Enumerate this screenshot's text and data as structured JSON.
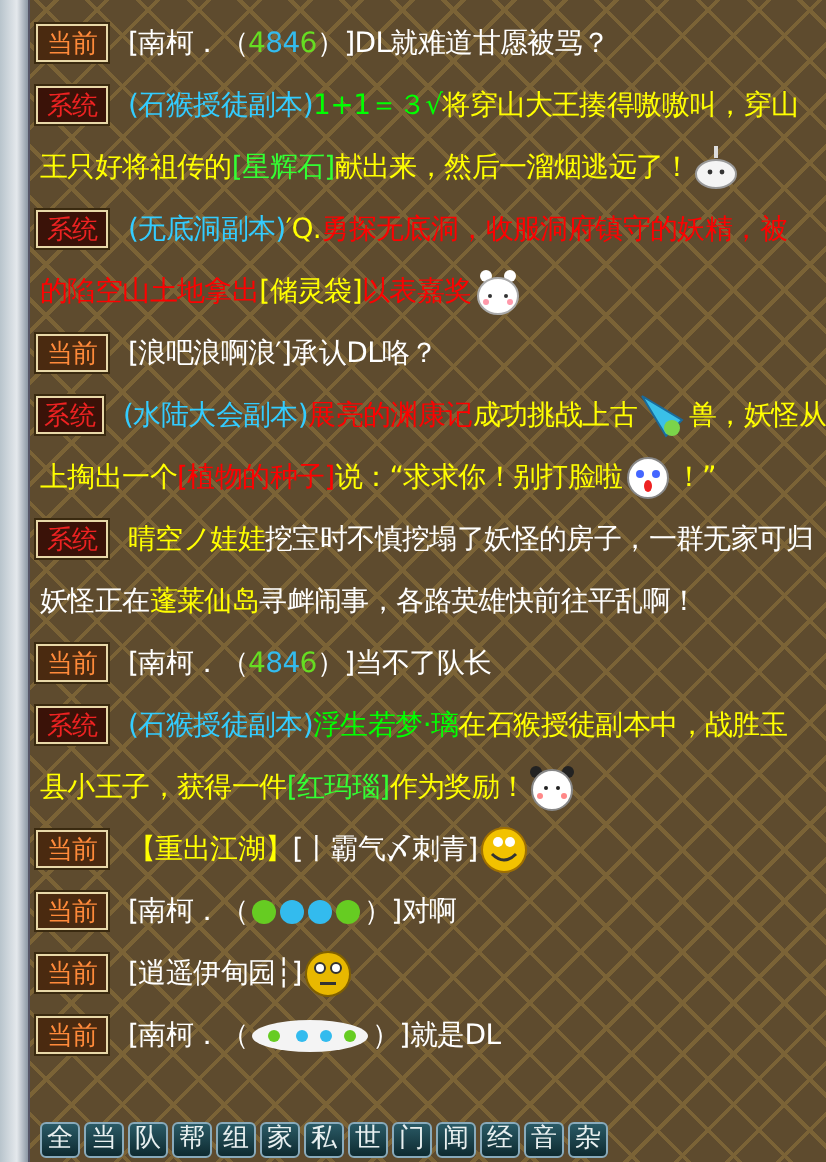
{
  "messages": [
    {
      "channel": {
        "kind": "current",
        "label": "当前"
      },
      "lines": [
        [
          {
            "text": "[南柯．（",
            "color": "#ffffff"
          },
          {
            "text": "4",
            "color": "#66dd22"
          },
          {
            "text": "8",
            "color": "#33bbee"
          },
          {
            "text": "4",
            "color": "#33bbee"
          },
          {
            "text": "6",
            "color": "#66dd22"
          },
          {
            "text": "）]DL就难道甘愿被骂？",
            "color": "#ffffff"
          }
        ]
      ]
    },
    {
      "channel": {
        "kind": "system",
        "label": "系统"
      },
      "lines": [
        [
          {
            "text": "(石猴授徒副本)",
            "color": "#33ccff"
          },
          {
            "text": "1+1＝３√",
            "color": "#00ff00"
          },
          {
            "text": "将穿山大王揍得嗷嗷叫，穿山",
            "color": "#ffff00"
          }
        ],
        [
          {
            "text": "王只好将祖传的",
            "color": "#ffff00"
          },
          {
            "text": "[星辉石]",
            "color": "#33ff33"
          },
          {
            "text": "献出来，然后一溜烟逃远了！",
            "color": "#ffff00"
          },
          {
            "kind": "ghost"
          }
        ]
      ]
    },
    {
      "channel": {
        "kind": "system",
        "label": "系统"
      },
      "lines": [
        [
          {
            "text": "(无底洞副本)",
            "color": "#33ccff"
          },
          {
            "text": "′Q.",
            "color": "#ffff00"
          },
          {
            "text": "勇探无底洞，收服洞府镇守的妖精，被",
            "color": "#ff0000"
          }
        ],
        [
          {
            "text": "的陷空山土地拿出",
            "color": "#ff0000"
          },
          {
            "text": "[储灵袋]",
            "color": "#ffff00"
          },
          {
            "text": "以表嘉奖",
            "color": "#ff0000"
          },
          {
            "kind": "bunny"
          }
        ]
      ]
    },
    {
      "channel": {
        "kind": "current",
        "label": "当前"
      },
      "lines": [
        [
          {
            "text": "[浪吧浪啊浪′]承认DL咯？",
            "color": "#ffffff"
          }
        ]
      ]
    },
    {
      "channel": {
        "kind": "system",
        "label": "系统"
      },
      "lines": [
        [
          {
            "text": "(水陆大会副本)",
            "color": "#33ccff"
          },
          {
            "text": "展亮的渊康记",
            "color": "#ff0000"
          },
          {
            "text": "成功挑战上古",
            "color": "#ffff00"
          },
          {
            "kind": "crystal"
          },
          {
            "text": "兽，妖怪从",
            "color": "#ffff00"
          }
        ],
        [
          {
            "text": "上掏出一个",
            "color": "#ffff00"
          },
          {
            "text": "[植物的种子]",
            "color": "#ff0000"
          },
          {
            "text": "说：“求求你！别打脸啦",
            "color": "#ffff00"
          },
          {
            "kind": "crying"
          },
          {
            "text": "！”",
            "color": "#ffff00"
          }
        ]
      ]
    },
    {
      "channel": {
        "kind": "system",
        "label": "系统"
      },
      "lines": [
        [
          {
            "text": "晴空ノ娃娃",
            "color": "#ffff00"
          },
          {
            "text": "挖宝时不慎挖塌了妖怪的房子，一群无家可归",
            "color": "#ffffff"
          }
        ],
        [
          {
            "text": "妖怪正在",
            "color": "#ffffff"
          },
          {
            "text": "蓬莱仙岛",
            "color": "#ffff00"
          },
          {
            "text": "寻衅闹事，各路英雄快前往平乱啊！",
            "color": "#ffffff"
          }
        ]
      ]
    },
    {
      "channel": {
        "kind": "current",
        "label": "当前"
      },
      "lines": [
        [
          {
            "text": "[南柯．（",
            "color": "#ffffff"
          },
          {
            "text": "4",
            "color": "#66dd22"
          },
          {
            "text": "8",
            "color": "#33bbee"
          },
          {
            "text": "4",
            "color": "#33bbee"
          },
          {
            "text": "6",
            "color": "#66dd22"
          },
          {
            "text": "）]当不了队长",
            "color": "#ffffff"
          }
        ]
      ]
    },
    {
      "channel": {
        "kind": "system",
        "label": "系统"
      },
      "lines": [
        [
          {
            "text": "(石猴授徒副本)",
            "color": "#33ccff"
          },
          {
            "text": "浮生若梦·璃",
            "color": "#00ff00"
          },
          {
            "text": "在石猴授徒副本中，战胜玉",
            "color": "#ffff00"
          }
        ],
        [
          {
            "text": "县小王子，获得一件",
            "color": "#ffff00"
          },
          {
            "text": "[红玛瑙]",
            "color": "#33ff33"
          },
          {
            "text": "作为奖励！",
            "color": "#ffff00"
          },
          {
            "kind": "panda"
          }
        ]
      ]
    },
    {
      "channel": {
        "kind": "current",
        "label": "当前"
      },
      "lines": [
        [
          {
            "text": "【重出江湖】",
            "color": "#ffff00"
          },
          {
            "text": "[丨霸气〆刺青]",
            "color": "#ffffff"
          },
          {
            "kind": "smiley"
          }
        ]
      ]
    },
    {
      "channel": {
        "kind": "current",
        "label": "当前"
      },
      "lines": [
        [
          {
            "text": "[南柯．（",
            "color": "#ffffff"
          },
          {
            "kind": "gems"
          },
          {
            "text": "）]对啊",
            "color": "#ffffff"
          }
        ]
      ]
    },
    {
      "channel": {
        "kind": "current",
        "label": "当前"
      },
      "lines": [
        [
          {
            "text": "[逍遥伊甸园┆]",
            "color": "#ffffff"
          },
          {
            "kind": "worried"
          }
        ]
      ]
    },
    {
      "channel": {
        "kind": "current",
        "label": "当前"
      },
      "lines": [
        [
          {
            "text": "[南柯．（",
            "color": "#ffffff"
          },
          {
            "kind": "sparkles"
          },
          {
            "text": "）]就是DL",
            "color": "#ffffff"
          }
        ]
      ]
    }
  ],
  "channel_tabs": [
    "全",
    "当",
    "队",
    "帮",
    "组",
    "家",
    "私",
    "世",
    "门",
    "闻",
    "经",
    "音",
    "杂"
  ]
}
